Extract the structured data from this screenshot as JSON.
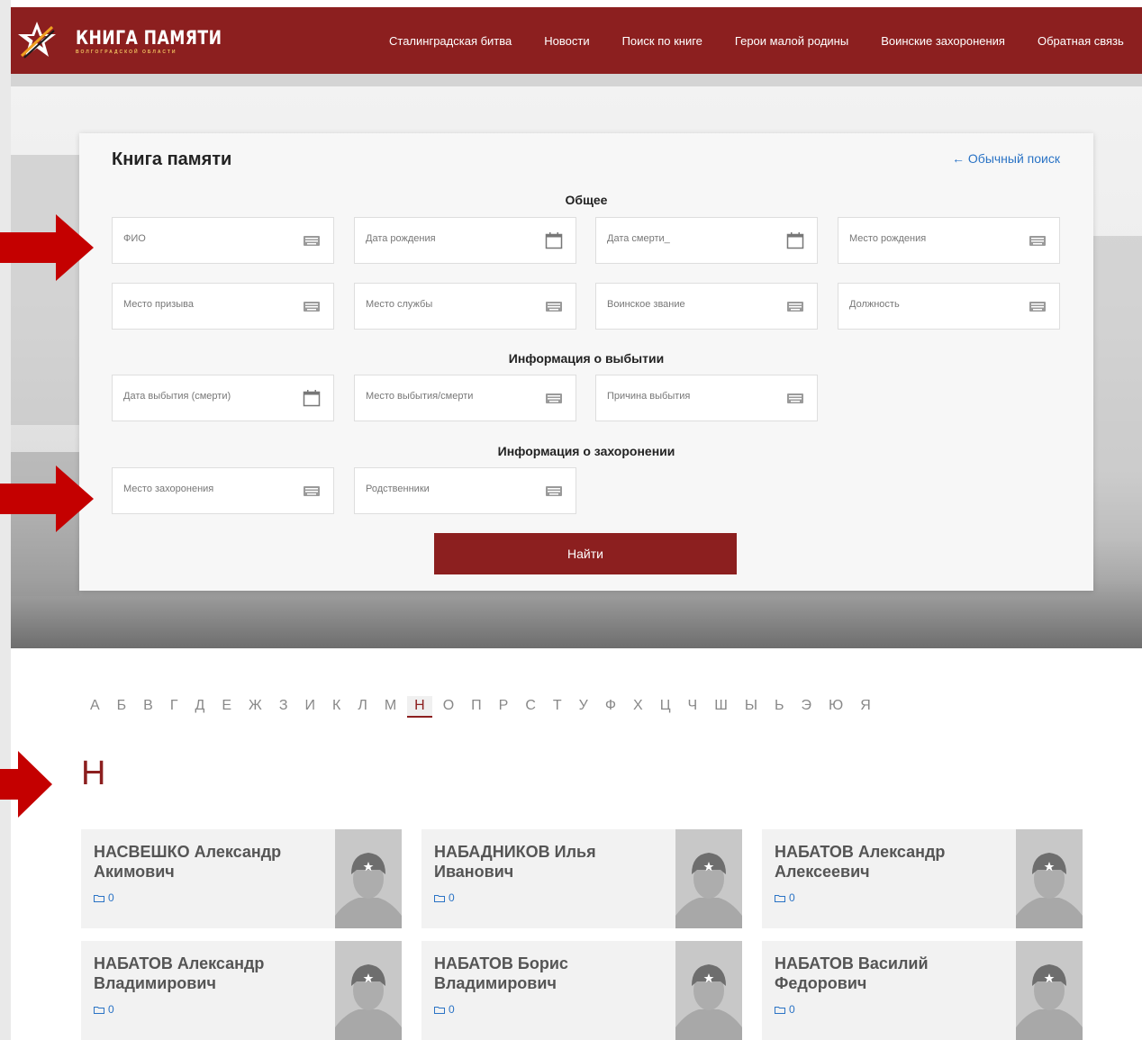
{
  "header": {
    "logo_title": "КНИГА ПАМЯТИ",
    "logo_subtitle": "ВОЛГОГРАДСКОЙ ОБЛАСТИ",
    "nav": [
      "Сталинградская битва",
      "Новости",
      "Поиск по книге",
      "Герои малой родины",
      "Воинские захоронения",
      "Обратная связь"
    ]
  },
  "search": {
    "title": "Книга памяти",
    "plain_search_link": "← Обычный поиск",
    "sections": {
      "general": "Общее",
      "departure": "Информация о выбытии",
      "burial": "Информация о захоронении"
    },
    "fields": {
      "fio": "ФИО",
      "birth_date": "Дата рождения",
      "death_date": "Дата смерти_",
      "birth_place": "Место рождения",
      "draft_place": "Место призыва",
      "service_place": "Место службы",
      "rank": "Воинское звание",
      "position": "Должность",
      "departure_date": "Дата выбытия (смерти)",
      "departure_place": "Место выбытия/смерти",
      "departure_reason": "Причина выбытия",
      "burial_place": "Место захоронения",
      "relatives": "Родственники"
    },
    "submit": "Найти"
  },
  "alphabet": {
    "letters": [
      "А",
      "Б",
      "В",
      "Г",
      "Д",
      "Е",
      "Ж",
      "З",
      "И",
      "К",
      "Л",
      "М",
      "Н",
      "О",
      "П",
      "Р",
      "С",
      "Т",
      "У",
      "Ф",
      "Х",
      "Ц",
      "Ч",
      "Ш",
      "Ы",
      "Ь",
      "Э",
      "Ю",
      "Я"
    ],
    "active": "Н"
  },
  "results": {
    "current_letter": "Н",
    "people": [
      {
        "name": "НАСВЕШКО Александр Акимович",
        "count": "0"
      },
      {
        "name": "НАБАДНИКОВ Илья Иванович",
        "count": "0"
      },
      {
        "name": "НАБАТОВ Александр Алексеевич",
        "count": "0"
      },
      {
        "name": "НАБАТОВ Александр Владимирович",
        "count": "0"
      },
      {
        "name": "НАБАТОВ Борис Владимирович",
        "count": "0"
      },
      {
        "name": "НАБАТОВ Василий Федорович",
        "count": "0"
      }
    ]
  },
  "colors": {
    "brand": "#8c1f1f",
    "link": "#2a73c5",
    "arrow": "#c40000"
  }
}
